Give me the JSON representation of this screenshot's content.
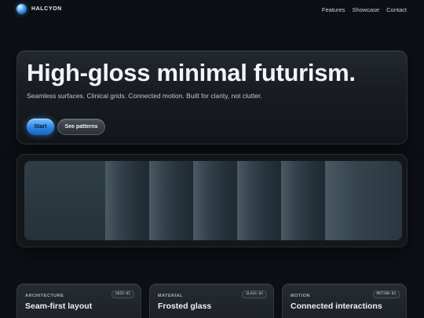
{
  "brand": {
    "name": "HALCYON"
  },
  "nav": {
    "items": [
      "Features",
      "Showcase",
      "Contact"
    ]
  },
  "hero": {
    "title": "High-gloss minimal futurism.",
    "subtitle": "Seamless surfaces. Clinical grids. Connected motion. Built for clarity, not clutter.",
    "primary_button": "Start",
    "secondary_button": "See patterns"
  },
  "showcase": {
    "band_count": 7
  },
  "cards": [
    {
      "kicker": "ARCHITECTURE",
      "tag": "GRID-01",
      "title": "Seam-first layout"
    },
    {
      "kicker": "MATERIAL",
      "tag": "GLASS-02",
      "title": "Frosted glass"
    },
    {
      "kicker": "MOTION",
      "tag": "MOTION-03",
      "title": "Connected interactions"
    }
  ],
  "colors": {
    "background": "#0c0f14",
    "accent": "#2b86e6",
    "panel": "#181c22"
  },
  "icons": {
    "brand": "halcyon-orb-logo"
  }
}
